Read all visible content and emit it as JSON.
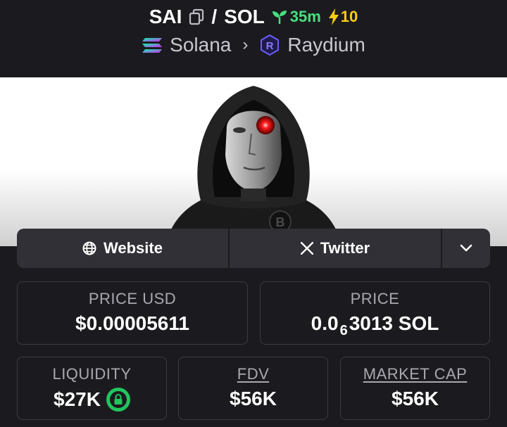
{
  "header": {
    "symbol": "SAI",
    "separator": "/",
    "quote": "SOL",
    "age": "35m",
    "boosts": "10",
    "chain": "Solana",
    "dex": "Raydium"
  },
  "links": {
    "website_label": "Website",
    "twitter_label": "Twitter"
  },
  "stats": {
    "price_usd_label": "PRICE USD",
    "price_usd_value": "$0.00005611",
    "price_label": "PRICE",
    "price_prefix": "0.0",
    "price_zeros": "6",
    "price_suffix": "3013 SOL",
    "liquidity_label": "LIQUIDITY",
    "liquidity_value": "$27K",
    "fdv_label": "FDV",
    "fdv_value": "$56K",
    "mcap_label": "MARKET CAP",
    "mcap_value": "$56K"
  },
  "colors": {
    "background": "#1b1b1f",
    "age_green": "#4ade80",
    "boost_yellow": "#facc15",
    "lock_green": "#22c55e",
    "eye_red": "#ff1a1a"
  },
  "icons": [
    "copy-icon",
    "sprout-icon",
    "bolt-icon",
    "solana-icon",
    "raydium-icon",
    "chevron-right-icon",
    "globe-icon",
    "x-icon",
    "chevron-down-icon",
    "lock-icon"
  ]
}
